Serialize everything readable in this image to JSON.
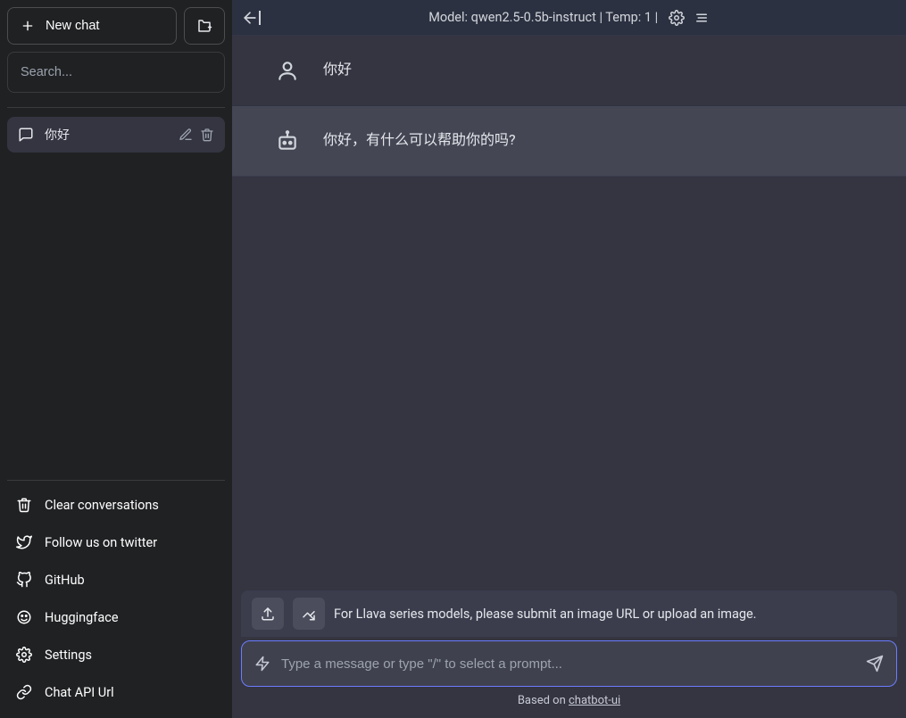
{
  "sidebar": {
    "new_chat_label": "New chat",
    "search_placeholder": "Search...",
    "conversations": [
      {
        "title": "你好"
      }
    ],
    "bottom_links": {
      "clear": "Clear conversations",
      "twitter": "Follow us on twitter",
      "github": "GitHub",
      "huggingface": "Huggingface",
      "settings": "Settings",
      "api_url": "Chat API Url"
    }
  },
  "header": {
    "title": "Model: qwen2.5-0.5b-instruct | Temp: 1 | "
  },
  "messages": [
    {
      "role": "user",
      "text": "你好"
    },
    {
      "role": "assistant",
      "text": "你好，有什么可以帮助你的吗?"
    }
  ],
  "input": {
    "hint": "For Llava series models, please submit an image URL or upload an image.",
    "placeholder": "Type a message or type \"/\" to select a prompt..."
  },
  "footer": {
    "prefix": "Based on ",
    "link": "chatbot-ui"
  }
}
